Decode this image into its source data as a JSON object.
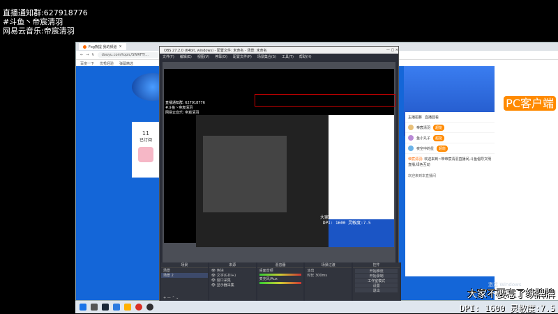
{
  "overlay": {
    "line1": "直播通知群:627918776",
    "line2": "#斗鱼丶帝宸清羽",
    "line3": "网易云音乐:帝宸清羽"
  },
  "browser": {
    "tab_title": "Fog熊提 我的频道",
    "url": "douyu.com/topic/SWRFT/...",
    "bookmarks": [
      "百度一下",
      "优秀经验",
      "弹幕精选"
    ]
  },
  "douyu": {
    "follow_count": "11",
    "follow_label": "已订阅",
    "pc_button": "PC客户端",
    "rank_tabs": [
      "主播招募",
      "直播回看"
    ],
    "rank_rows": [
      {
        "name": "帝宸清羽",
        "badge": "超能"
      },
      {
        "name": "鱼小丸子",
        "badge": "超能"
      },
      {
        "name": "夜空中的星",
        "badge": "超能"
      }
    ],
    "chat_text": "欢迎来到~带帝宸清羽直播间,斗鱼倡导文明直播,绿色互动",
    "chat_user": "帝宸清羽",
    "chat_footer": "欢迎来到本直播间"
  },
  "obs": {
    "title": "OBS 27.2.0 (64bit, windows) - 配置文件: 未命名 - 场景: 未命名",
    "menu": [
      "文件(F)",
      "编辑(E)",
      "视图(V)",
      "停靠(D)",
      "配置文件(P)",
      "场景集合(S)",
      "工具(T)",
      "帮助(H)"
    ],
    "docks": {
      "scenes": "场景",
      "sources": "来源",
      "mixer": "混音器",
      "transitions": "场景过渡",
      "controls": "控件"
    },
    "scene_items": [
      "场景",
      "场景 2"
    ],
    "source_items": [
      "色块",
      "文字(GDI+)",
      "窗口采集",
      "显示器采集"
    ],
    "mixer_items": [
      "桌面音频",
      "麦克风/Aux"
    ],
    "transition_value": "淡出",
    "duration_label": "时长",
    "duration_value": "300ms",
    "control_buttons": [
      "开始推流",
      "开始录制",
      "工作室模式",
      "设置",
      "退出"
    ],
    "status": "LIVE: 00:00:00   REC: 00:00:00   CPU: 1.3%, 60.00 fps",
    "canvas_text": [
      "直播通知群: 627918776",
      "#斗鱼丶帝宸清羽",
      "网易云音乐: 帝宸清羽"
    ]
  },
  "taskbar": {
    "activate_text": "激活 Windows"
  },
  "captions": {
    "main": "大家不要忘了续牌牌",
    "dpi": "DPI: 1600 灵敏度:7.5"
  },
  "nested_captions": {
    "line1": "大家不要忘了续牌牌",
    "line2": "DPI: 1600 灵敏度:7.5"
  }
}
